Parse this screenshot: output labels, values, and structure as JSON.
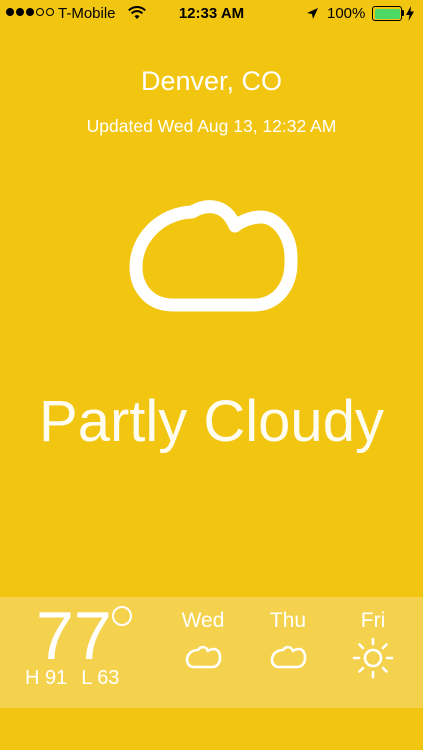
{
  "status_bar": {
    "carrier": "T-Mobile",
    "time": "12:33 AM",
    "battery": "100%",
    "signal_bars_filled": 3,
    "signal_bars_total": 5
  },
  "weather": {
    "city": "Denver, CO",
    "updated": "Updated Wed Aug 13, 12:32 AM",
    "condition": "Partly Cloudy",
    "main_icon": "cloud-icon"
  },
  "current": {
    "temp": "77",
    "high": "H 91",
    "low": "L 63"
  },
  "forecast": [
    {
      "day": "Wed",
      "icon": "cloud-icon"
    },
    {
      "day": "Thu",
      "icon": "cloud-icon"
    },
    {
      "day": "Fri",
      "icon": "sun-icon"
    }
  ],
  "colors": {
    "background": "#F2C511",
    "forecast_bar": "#F4D24E",
    "text": "#FFFFFF",
    "battery": "#4CD964"
  }
}
